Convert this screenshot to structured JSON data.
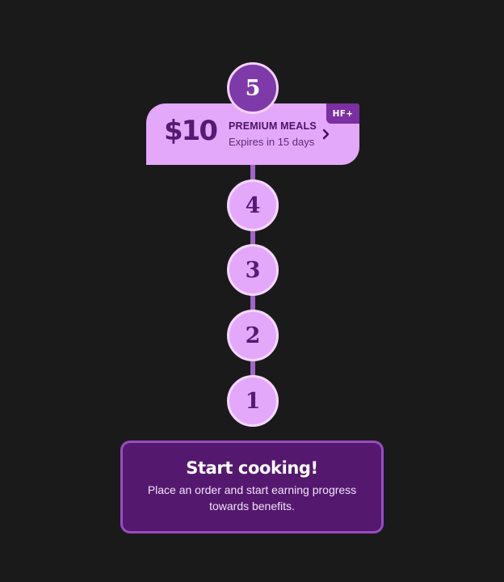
{
  "reward": {
    "amount": "$10",
    "title": "PREMIUM MEALS",
    "expiry": "Expires in 15 days",
    "badge": "HF+",
    "icon": "chevron-right-icon"
  },
  "steps": [
    {
      "label": "5",
      "state": "active"
    },
    {
      "label": "4",
      "state": "default"
    },
    {
      "label": "3",
      "state": "default"
    },
    {
      "label": "2",
      "state": "default"
    },
    {
      "label": "1",
      "state": "default"
    }
  ],
  "start": {
    "title": "Start cooking!",
    "description": "Place an order and start earning progress towards benefits."
  },
  "colors": {
    "background": "#1a1a1a",
    "card": "#e4a8fb",
    "accent": "#541a74",
    "start_card": "#55186f"
  }
}
